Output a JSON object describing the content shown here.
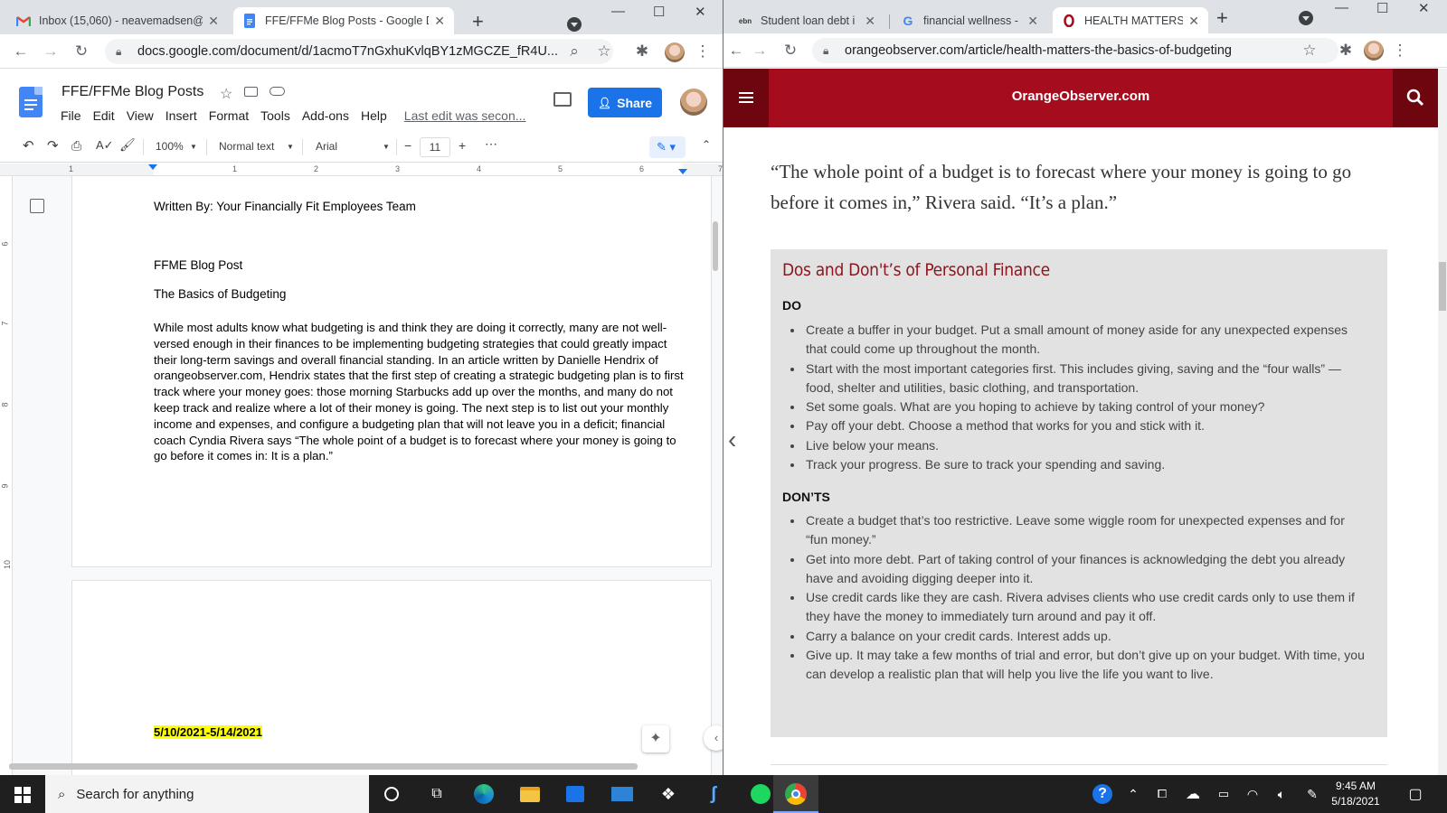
{
  "left_window": {
    "tabs": [
      {
        "title": "Inbox (15,060) - neavemadsen@",
        "favicon": "gmail-icon"
      },
      {
        "title": "FFE/FFMe Blog Posts - Google Do",
        "favicon": "docs-icon"
      }
    ],
    "url": "docs.google.com/document/d/1acmoT7nGxhuKvlqBY1zMGCZE_fR4U...",
    "doc_title": "FFE/FFMe Blog Posts",
    "menu": [
      "File",
      "Edit",
      "View",
      "Insert",
      "Format",
      "Tools",
      "Add-ons",
      "Help"
    ],
    "last_edit": "Last edit was secon...",
    "share_label": "Share",
    "zoom": "100%",
    "style": "Normal text",
    "font": "Arial",
    "font_size": "11",
    "ruler_top": [
      "1",
      "1",
      "2",
      "3",
      "4",
      "5",
      "6",
      "7"
    ],
    "ruler_side": [
      "6",
      "7",
      "8",
      "9",
      "10"
    ],
    "content": {
      "written_by": "Written By: Your Financially Fit Employees Team",
      "heading1": "FFME Blog Post",
      "heading2": "The Basics of Budgeting",
      "paragraph": "While most adults know what budgeting is and think they are doing it correctly, many are not well-versed enough in their finances to be implementing budgeting strategies that could greatly impact their long-term savings and overall financial standing. In an article written by Danielle Hendrix of orangeobserver.com, Hendrix states that the first step of creating a strategic budgeting plan is to first track where your money goes: those morning Starbucks add up over the months, and many do not keep track and realize where a lot of their money is going. The next step is to list out your monthly income and expenses, and configure a budgeting plan that will not leave you in a deficit; financial coach Cyndia Rivera says “The whole point of a budget is to forecast where your money is going to go before it comes in: It is a plan.”",
      "date_range": "5/10/2021-5/14/2021"
    }
  },
  "right_window": {
    "tabs": [
      {
        "title": "Student loan debt i",
        "favicon": "ebn-icon"
      },
      {
        "title": "financial wellness -",
        "favicon": "google-icon"
      },
      {
        "title": "HEALTH MATTERS:",
        "favicon": "orange-observer-icon"
      }
    ],
    "url": "orangeobserver.com/article/health-matters-the-basics-of-budgeting",
    "brand": "OrangeObserver.com",
    "quote": "“The whole point of a budget is to forecast where your money is going to go before it comes in,” Rivera said. “It’s a plan.”",
    "box_title": "Dos and Don't’s of Personal Finance",
    "do_label": "DO",
    "do_items": [
      "Create a buffer in your budget. Put a small amount of money aside for any unexpected expenses that could come up throughout the month.",
      "Start with the most important categories first. This includes giving, saving and the “four walls” — food, shelter and utilities, basic clothing, and transportation.",
      "Set some goals. What are you hoping to achieve by taking control of your money?",
      "Pay off your debt. Choose a method that works for you and stick with it.",
      "Live below your means.",
      "Track your progress. Be sure to track your spending and saving."
    ],
    "dont_label": "DON’TS",
    "dont_items": [
      "Create a budget that’s too restrictive. Leave some wiggle room for unexpected expenses and for “fun money.”",
      "Get into more debt. Part of taking control of your finances is acknowledging the debt you already have and avoiding digging deeper into it.",
      "Use credit cards like they are cash. Rivera advises clients who use credit cards only to use them if they have the money to immediately turn around and pay it off.",
      "Carry a balance on your credit cards. Interest adds up.",
      "Give up. It may take a few months of trial and error, but don’t give up on your budget. With time, you can develop a realistic plan that will help you live the life you want to live."
    ]
  },
  "taskbar": {
    "search_placeholder": "Search for anything",
    "time": "9:45 AM",
    "date": "5/18/2021"
  },
  "colors": {
    "brand_red": "#a50d1e",
    "docs_blue": "#1a73e8",
    "highlight": "#ffff00"
  }
}
